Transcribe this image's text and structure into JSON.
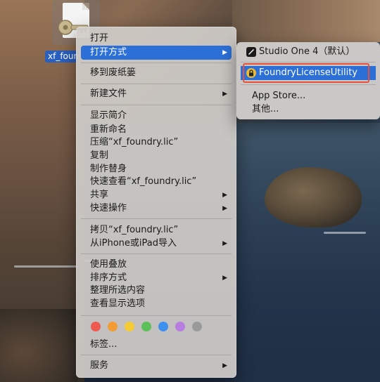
{
  "file": {
    "name": "xf_foundry.lic",
    "label_visible": "xf_foun"
  },
  "menu": {
    "items": [
      {
        "label": "打开",
        "arrow": false
      },
      {
        "label": "打开方式",
        "arrow": true,
        "highlighted": true
      },
      {
        "label": "移到废纸篓",
        "arrow": false
      },
      {
        "label": "新建文件",
        "arrow": true
      },
      {
        "label": "显示简介",
        "arrow": false
      },
      {
        "label": "重新命名",
        "arrow": false
      },
      {
        "label": "压缩“xf_foundry.lic”",
        "arrow": false
      },
      {
        "label": "复制",
        "arrow": false
      },
      {
        "label": "制作替身",
        "arrow": false
      },
      {
        "label": "快速查看“xf_foundry.lic”",
        "arrow": false
      },
      {
        "label": "共享",
        "arrow": true
      },
      {
        "label": "快速操作",
        "arrow": true
      },
      {
        "label": "拷贝“xf_foundry.lic”",
        "arrow": false
      },
      {
        "label": "从iPhone或iPad导入",
        "arrow": true
      },
      {
        "label": "使用叠放",
        "arrow": false
      },
      {
        "label": "排序方式",
        "arrow": true
      },
      {
        "label": "整理所选内容",
        "arrow": false
      },
      {
        "label": "查看显示选项",
        "arrow": false
      },
      {
        "label": "标签...",
        "arrow": false
      },
      {
        "label": "服务",
        "arrow": true
      }
    ],
    "arrow_glyph": "▶",
    "tag_colors": [
      "#ee5a52",
      "#f39c35",
      "#f5cb36",
      "#5cc05a",
      "#3d8ff0",
      "#b77de0",
      "#9a9a9a"
    ]
  },
  "submenu": {
    "items": [
      {
        "label": "Studio One 4（默认）",
        "icon": "studio-one-icon"
      },
      {
        "label": "FoundryLicenseUtility",
        "icon": "foundry-lock-icon",
        "highlighted": true
      },
      {
        "label": "App Store...",
        "icon": ""
      },
      {
        "label": "其他...",
        "icon": ""
      }
    ]
  },
  "colors": {
    "highlight": "#2c6fd6",
    "annotation": "#e8503a"
  }
}
